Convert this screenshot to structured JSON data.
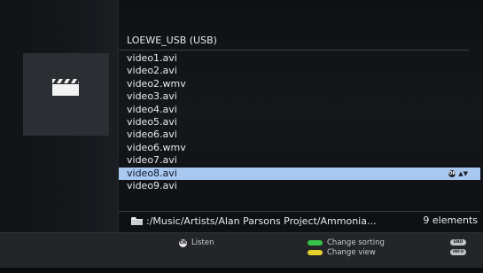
{
  "browser": {
    "title": "LOEWE_USB (USB)",
    "icon": "film-clapper-icon"
  },
  "files": [
    {
      "name": "video1.avi",
      "selected": false
    },
    {
      "name": "video2.avi",
      "selected": false
    },
    {
      "name": "video2.wmv",
      "selected": false
    },
    {
      "name": "video3.avi",
      "selected": false
    },
    {
      "name": "video4.avi",
      "selected": false
    },
    {
      "name": "video5.avi",
      "selected": false
    },
    {
      "name": "video6.avi",
      "selected": false
    },
    {
      "name": "video6.wmv",
      "selected": false
    },
    {
      "name": "video7.avi",
      "selected": false
    },
    {
      "name": "video8.avi",
      "selected": true
    },
    {
      "name": "video9.avi",
      "selected": false
    }
  ],
  "selection_icons": {
    "ok_badge": "OK",
    "updown": "▲▼"
  },
  "path": {
    "text": ":/Music/Artists/Alan Parsons Project/Ammonia...",
    "count": "9 elements",
    "icon": "folder-icon"
  },
  "footer": {
    "listen": {
      "badge": "OK",
      "label": "Listen"
    },
    "change_sorting": {
      "label": "Change sorting",
      "color": "#36c246"
    },
    "change_view": {
      "label": "Change view",
      "color": "#e6d02c"
    },
    "end_key": "END",
    "info_key": "INFO"
  },
  "colors": {
    "selection": "#a9c8ef",
    "background": "#0e1013",
    "footer": "#232528"
  }
}
